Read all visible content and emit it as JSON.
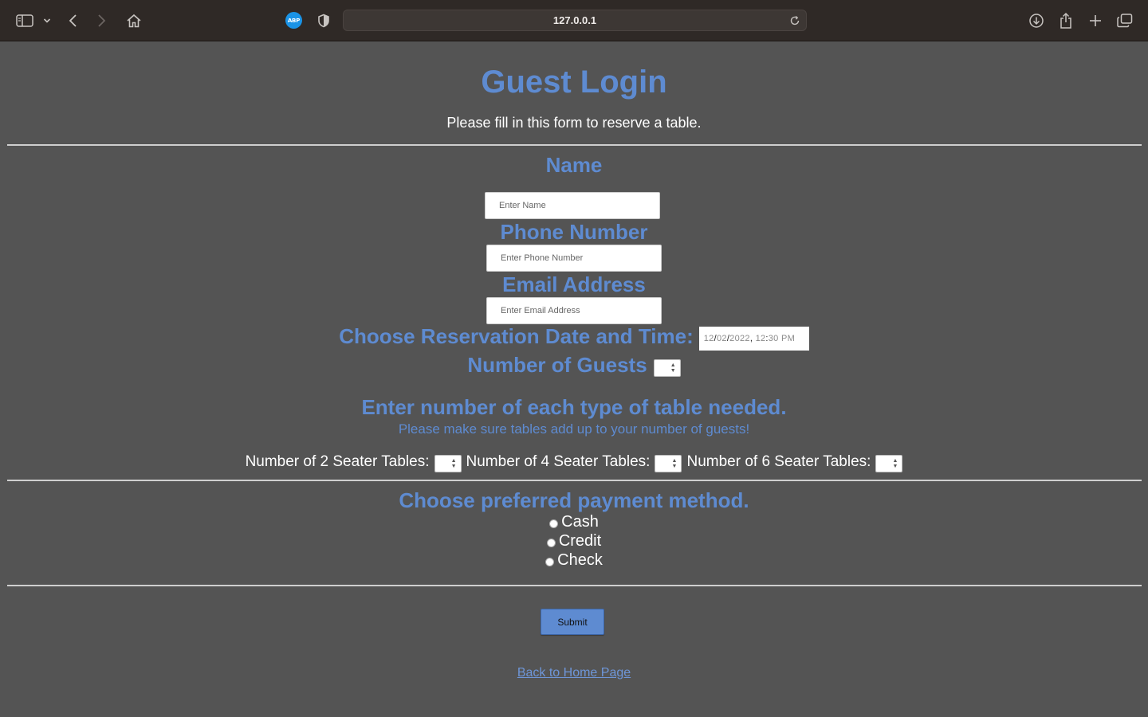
{
  "browser": {
    "url": "127.0.0.1",
    "adblock_label": "ABP",
    "icons": {
      "sidebar": "sidebar-icon",
      "back": "chevron-left-icon",
      "forward": "chevron-right-icon",
      "home": "home-icon",
      "shield": "shield-icon",
      "reload": "reload-icon",
      "download": "download-icon",
      "share": "share-icon",
      "new_tab": "plus-icon",
      "tabs": "tabs-overview-icon"
    }
  },
  "form": {
    "title": "Guest Login",
    "subtitle": "Please fill in this form to reserve a table.",
    "name": {
      "label": "Name",
      "placeholder": "Enter Name",
      "value": ""
    },
    "phone": {
      "label": "Phone Number",
      "placeholder": "Enter Phone Number",
      "value": ""
    },
    "email": {
      "label": "Email Address",
      "placeholder": "Enter Email Address",
      "value": ""
    },
    "datetime": {
      "label": "Choose Reservation Date and Time:",
      "month": "12",
      "day": "02",
      "year": "2022",
      "hour": "12",
      "minute": "30",
      "ampm": "PM"
    },
    "guests": {
      "label": "Number of Guests",
      "value": ""
    },
    "tables": {
      "heading": "Enter number of each type of table needed.",
      "note": "Please make sure tables add up to your number of guests!",
      "two_seater_label": "Number of 2 Seater Tables:",
      "four_seater_label": "Number of 4 Seater Tables:",
      "six_seater_label": "Number of 6 Seater Tables:"
    },
    "payment": {
      "heading": "Choose preferred payment method.",
      "options": [
        "Cash",
        "Credit",
        "Check"
      ],
      "selected": null
    },
    "submit_label": "Submit",
    "home_link": "Back to Home Page"
  },
  "colors": {
    "page_bg": "#545454",
    "accent_blue": "#5e8bd1",
    "toolbar_bg": "#2f2926"
  }
}
